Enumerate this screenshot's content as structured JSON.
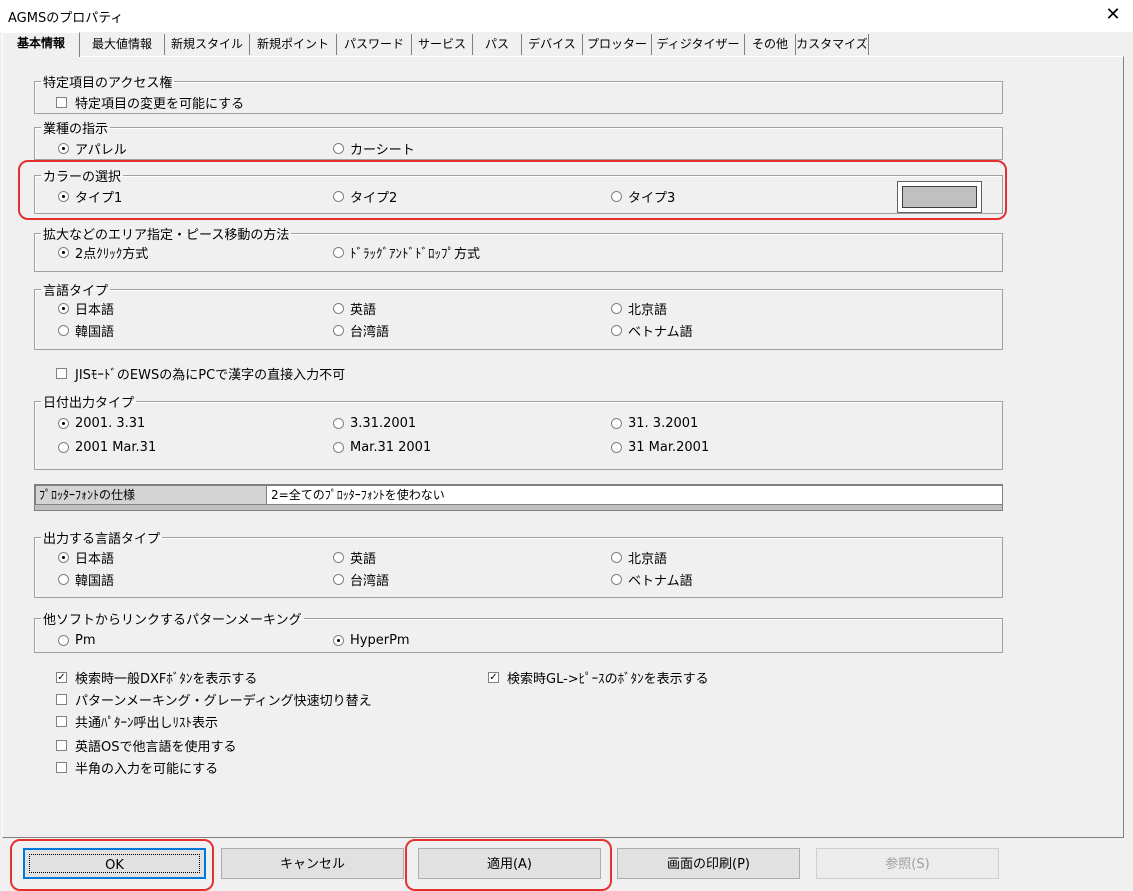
{
  "window": {
    "title": "AGMSのプロパティ",
    "close": "✕"
  },
  "tabs": [
    "基本情報",
    "最大値情報",
    "新規スタイル",
    "新規ポイント",
    "パスワード",
    "サービス",
    "パス",
    "デバイス",
    "プロッター",
    "ディジタイザー",
    "その他",
    "カスタマイズ"
  ],
  "access": {
    "legend": "特定項目のアクセス権",
    "check": "特定項目の変更を可能にする"
  },
  "industry": {
    "legend": "業種の指示",
    "opt1": "アパレル",
    "opt2": "カーシート"
  },
  "color": {
    "legend": "カラーの選択",
    "opt1": "タイプ1",
    "opt2": "タイプ2",
    "opt3": "タイプ3"
  },
  "areaMethod": {
    "legend": "拡大などのエリア指定・ピース移動の方法",
    "opt1": "2点ｸﾘｯｸ方式",
    "opt2": "ﾄﾞﾗｯｸﾞｱﾝﾄﾞﾄﾞﾛｯﾌﾟ方式"
  },
  "language": {
    "legend": "言語タイプ",
    "ja": "日本語",
    "en": "英語",
    "bj": "北京語",
    "ko": "韓国語",
    "tw": "台湾語",
    "vi": "ベトナム語"
  },
  "jisCheck": "JISﾓｰﾄﾞのEWSの為にPCで漢字の直接入力不可",
  "dateType": {
    "legend": "日付出力タイプ",
    "o1": "2001. 3.31",
    "o2": " 3.31.2001",
    "o3": "31. 3.2001",
    "o4": "2001 Mar.31",
    "o5": "Mar.31 2001",
    "o6": "31 Mar.2001"
  },
  "plotterFont": {
    "label": "ﾌﾟﾛｯﾀｰﾌｫﾝﾄの仕様",
    "value": "2=全てのﾌﾟﾛｯﾀｰﾌｫﾝﾄを使わない"
  },
  "outLanguage": {
    "legend": "出力する言語タイプ",
    "ja": "日本語",
    "en": "英語",
    "bj": "北京語",
    "ko": "韓国語",
    "tw": "台湾語",
    "vi": "ベトナム語"
  },
  "linkMaking": {
    "legend": "他ソフトからリンクするパターンメーキング",
    "opt1": "Pm",
    "opt2": "HyperPm"
  },
  "checks": {
    "dxf": "検索時一般DXFﾎﾞﾀﾝを表示する",
    "gl": "検索時GL->ﾋﾟｰｽのﾎﾞﾀﾝを表示する",
    "grading": "パターンメーキング・グレーディング快速切り替え",
    "callList": "共通ﾊﾟﾀｰﾝ呼出しﾘｽﾄ表示",
    "englishOS": "英語OSで他言語を使用する",
    "hankaku": "半角の入力を可能にする"
  },
  "buttons": {
    "ok": "OK",
    "cancel": "キャンセル",
    "apply": "適用(A)",
    "print": "画面の印刷(P)",
    "browse": "参照(S)"
  },
  "colors": {
    "accent": "#0078d7",
    "highlight": "#e53030",
    "face": "#f0f0f0"
  }
}
